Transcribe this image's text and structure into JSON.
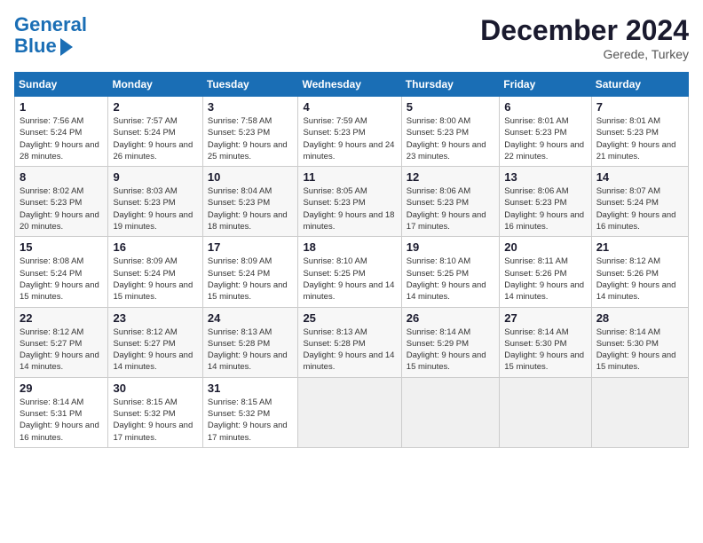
{
  "logo": {
    "line1": "General",
    "line2": "Blue"
  },
  "title": "December 2024",
  "location": "Gerede, Turkey",
  "days_of_week": [
    "Sunday",
    "Monday",
    "Tuesday",
    "Wednesday",
    "Thursday",
    "Friday",
    "Saturday"
  ],
  "weeks": [
    [
      {
        "day": "1",
        "sunrise": "7:56 AM",
        "sunset": "5:24 PM",
        "daylight": "9 hours and 28 minutes."
      },
      {
        "day": "2",
        "sunrise": "7:57 AM",
        "sunset": "5:24 PM",
        "daylight": "9 hours and 26 minutes."
      },
      {
        "day": "3",
        "sunrise": "7:58 AM",
        "sunset": "5:23 PM",
        "daylight": "9 hours and 25 minutes."
      },
      {
        "day": "4",
        "sunrise": "7:59 AM",
        "sunset": "5:23 PM",
        "daylight": "9 hours and 24 minutes."
      },
      {
        "day": "5",
        "sunrise": "8:00 AM",
        "sunset": "5:23 PM",
        "daylight": "9 hours and 23 minutes."
      },
      {
        "day": "6",
        "sunrise": "8:01 AM",
        "sunset": "5:23 PM",
        "daylight": "9 hours and 22 minutes."
      },
      {
        "day": "7",
        "sunrise": "8:01 AM",
        "sunset": "5:23 PM",
        "daylight": "9 hours and 21 minutes."
      }
    ],
    [
      {
        "day": "8",
        "sunrise": "8:02 AM",
        "sunset": "5:23 PM",
        "daylight": "9 hours and 20 minutes."
      },
      {
        "day": "9",
        "sunrise": "8:03 AM",
        "sunset": "5:23 PM",
        "daylight": "9 hours and 19 minutes."
      },
      {
        "day": "10",
        "sunrise": "8:04 AM",
        "sunset": "5:23 PM",
        "daylight": "9 hours and 18 minutes."
      },
      {
        "day": "11",
        "sunrise": "8:05 AM",
        "sunset": "5:23 PM",
        "daylight": "9 hours and 18 minutes."
      },
      {
        "day": "12",
        "sunrise": "8:06 AM",
        "sunset": "5:23 PM",
        "daylight": "9 hours and 17 minutes."
      },
      {
        "day": "13",
        "sunrise": "8:06 AM",
        "sunset": "5:23 PM",
        "daylight": "9 hours and 16 minutes."
      },
      {
        "day": "14",
        "sunrise": "8:07 AM",
        "sunset": "5:24 PM",
        "daylight": "9 hours and 16 minutes."
      }
    ],
    [
      {
        "day": "15",
        "sunrise": "8:08 AM",
        "sunset": "5:24 PM",
        "daylight": "9 hours and 15 minutes."
      },
      {
        "day": "16",
        "sunrise": "8:09 AM",
        "sunset": "5:24 PM",
        "daylight": "9 hours and 15 minutes."
      },
      {
        "day": "17",
        "sunrise": "8:09 AM",
        "sunset": "5:24 PM",
        "daylight": "9 hours and 15 minutes."
      },
      {
        "day": "18",
        "sunrise": "8:10 AM",
        "sunset": "5:25 PM",
        "daylight": "9 hours and 14 minutes."
      },
      {
        "day": "19",
        "sunrise": "8:10 AM",
        "sunset": "5:25 PM",
        "daylight": "9 hours and 14 minutes."
      },
      {
        "day": "20",
        "sunrise": "8:11 AM",
        "sunset": "5:26 PM",
        "daylight": "9 hours and 14 minutes."
      },
      {
        "day": "21",
        "sunrise": "8:12 AM",
        "sunset": "5:26 PM",
        "daylight": "9 hours and 14 minutes."
      }
    ],
    [
      {
        "day": "22",
        "sunrise": "8:12 AM",
        "sunset": "5:27 PM",
        "daylight": "9 hours and 14 minutes."
      },
      {
        "day": "23",
        "sunrise": "8:12 AM",
        "sunset": "5:27 PM",
        "daylight": "9 hours and 14 minutes."
      },
      {
        "day": "24",
        "sunrise": "8:13 AM",
        "sunset": "5:28 PM",
        "daylight": "9 hours and 14 minutes."
      },
      {
        "day": "25",
        "sunrise": "8:13 AM",
        "sunset": "5:28 PM",
        "daylight": "9 hours and 14 minutes."
      },
      {
        "day": "26",
        "sunrise": "8:14 AM",
        "sunset": "5:29 PM",
        "daylight": "9 hours and 15 minutes."
      },
      {
        "day": "27",
        "sunrise": "8:14 AM",
        "sunset": "5:30 PM",
        "daylight": "9 hours and 15 minutes."
      },
      {
        "day": "28",
        "sunrise": "8:14 AM",
        "sunset": "5:30 PM",
        "daylight": "9 hours and 15 minutes."
      }
    ],
    [
      {
        "day": "29",
        "sunrise": "8:14 AM",
        "sunset": "5:31 PM",
        "daylight": "9 hours and 16 minutes."
      },
      {
        "day": "30",
        "sunrise": "8:15 AM",
        "sunset": "5:32 PM",
        "daylight": "9 hours and 17 minutes."
      },
      {
        "day": "31",
        "sunrise": "8:15 AM",
        "sunset": "5:32 PM",
        "daylight": "9 hours and 17 minutes."
      },
      null,
      null,
      null,
      null
    ]
  ],
  "labels": {
    "sunrise": "Sunrise:",
    "sunset": "Sunset:",
    "daylight": "Daylight:"
  }
}
